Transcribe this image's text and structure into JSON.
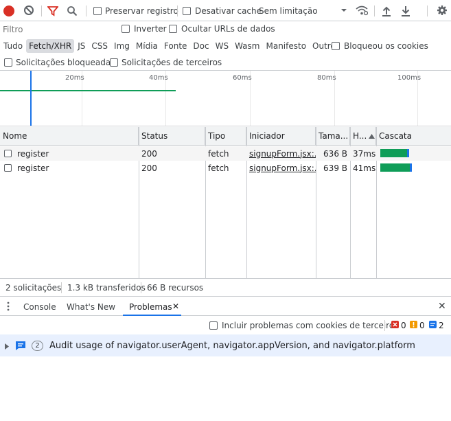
{
  "toolbar": {
    "preserve_log": "Preservar registro",
    "disable_cache": "Desativar cache",
    "throttling": "Sem limitação"
  },
  "filter": {
    "placeholder": "Filtro",
    "invert": "Inverter",
    "hide_data_urls": "Ocultar URLs de dados"
  },
  "types": [
    "Tudo",
    "Fetch/XHR",
    "JS",
    "CSS",
    "Img",
    "Mídia",
    "Fonte",
    "Doc",
    "WS",
    "Wasm",
    "Manifesto",
    "Outro"
  ],
  "blocked_cookies": "Bloqueou os cookies",
  "blocked_requests": "Solicitações bloqueadas",
  "third_party_requests": "Solicitações de terceiros",
  "overview": {
    "ticks": [
      "20ms",
      "40ms",
      "60ms",
      "80ms",
      "100ms"
    ]
  },
  "table": {
    "headers": {
      "name": "Nome",
      "status": "Status",
      "type": "Tipo",
      "initiator": "Iniciador",
      "size": "Tama...",
      "time": "H...",
      "waterfall": "Cascata"
    },
    "rows": [
      {
        "name": "register",
        "status": "200",
        "type": "fetch",
        "initiator": "signupForm.jsx:...",
        "size": "636 B",
        "time": "37ms",
        "bar_fraction": 0.42
      },
      {
        "name": "register",
        "status": "200",
        "type": "fetch",
        "initiator": "signupForm.jsx:...",
        "size": "639 B",
        "time": "41ms",
        "bar_fraction": 0.46
      }
    ]
  },
  "status": {
    "requests": "2 solicitações",
    "transferred": "1.3 kB transferidos",
    "resources": "66 B recursos"
  },
  "drawer": {
    "tabs": [
      "Console",
      "What's New",
      "Problemas"
    ],
    "active_tab": "Problemas",
    "include_third_party": "Incluir problemas com cookies de terceiros",
    "counts": {
      "errors": "0",
      "warnings": "0",
      "info": "2"
    },
    "issue": {
      "count": "2",
      "text": "Audit usage of navigator.userAgent, navigator.appVersion, and navigator.platform"
    }
  },
  "colors": {
    "record_red": "#d93025",
    "filter_red": "#d93025",
    "waterfall_green": "#0f9d58",
    "waterfall_blue": "#1a73e8",
    "accent_blue": "#1a73e8"
  }
}
